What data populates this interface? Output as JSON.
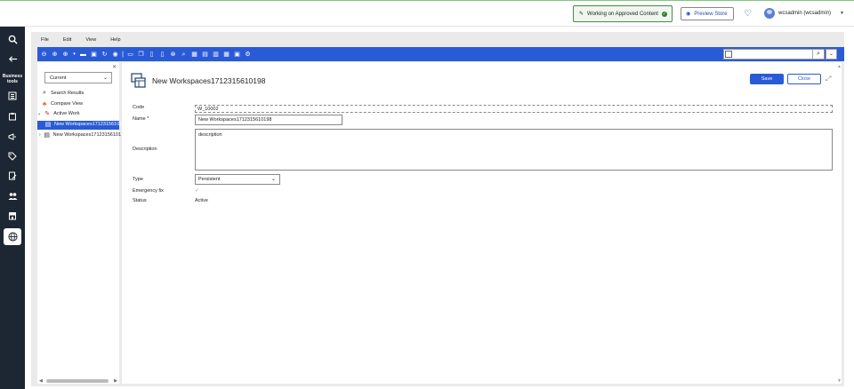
{
  "topbar": {
    "approved_label": "Working on Approved Content",
    "preview_label": "Preview Store",
    "username": "wcsadmin (wcsadmin)"
  },
  "rail": {
    "business_tools_label": "Business tools"
  },
  "menu": [
    "File",
    "Edit",
    "View",
    "Help"
  ],
  "leftnav": {
    "current_option": "Current",
    "items": [
      {
        "label": "Search Results"
      },
      {
        "label": "Compare View"
      },
      {
        "label": "Active Work"
      },
      {
        "label": "New Workspaces17123156101"
      },
      {
        "label": "New Workspaces17123156101"
      }
    ]
  },
  "workspace": {
    "title": "New Workspaces1712315610198",
    "save_label": "Save",
    "close_label": "Close",
    "fields": {
      "code_label": "Code",
      "code_value": "W_10002",
      "name_label": "Name *",
      "name_value": "New Workspaces1712315610198",
      "description_label": "Description",
      "description_value": "description",
      "type_label": "Type",
      "type_value": "Persistent",
      "emergency_label": "Emergency fix",
      "status_label": "Status",
      "status_value": "Active"
    }
  },
  "colors": {
    "accent": "#2a5bd7",
    "rail": "#1c2733",
    "approved_green": "#2e7d32"
  }
}
